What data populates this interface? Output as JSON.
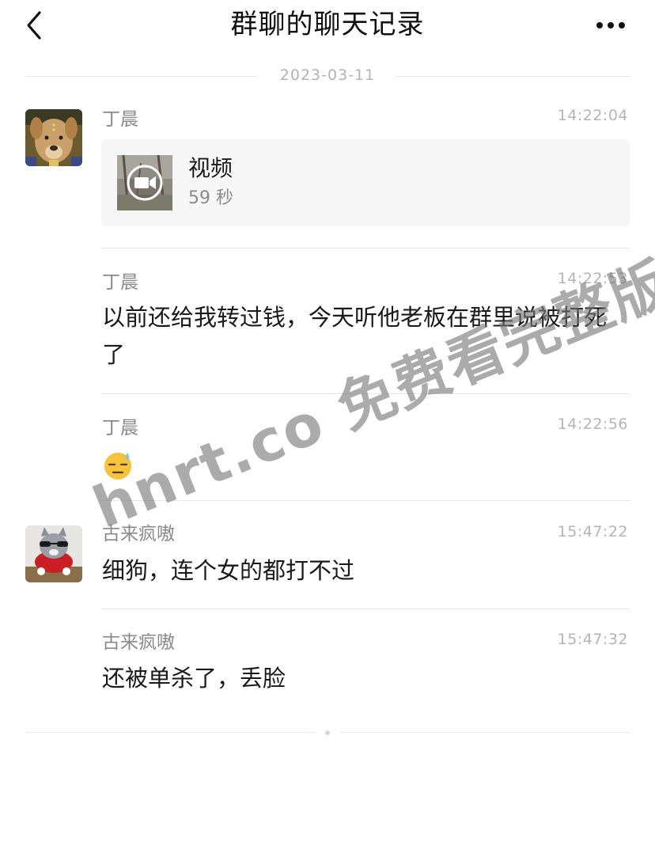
{
  "header": {
    "title": "群聊的聊天记录",
    "back_icon": "chevron-left-icon",
    "more_icon": "more-dots-icon"
  },
  "date_divider": "2023-03-11",
  "messages": [
    {
      "sender": "丁晨",
      "time": "14:22:04",
      "type": "video",
      "video": {
        "title": "视频",
        "duration": "59 秒"
      }
    },
    {
      "sender": "丁晨",
      "time": "14:22:53",
      "type": "text",
      "text": "以前还给我转过钱，今天听他老板在群里说被打死了"
    },
    {
      "sender": "丁晨",
      "time": "14:22:56",
      "type": "emoji",
      "emoji": "😓"
    },
    {
      "sender": "古来疯嗷",
      "time": "15:47:22",
      "type": "text",
      "text": "细狗，连个女的都打不过"
    },
    {
      "sender": "古来疯嗷",
      "time": "15:47:32",
      "type": "text",
      "text": "还被单杀了，丢脸"
    }
  ],
  "watermark": "hnrt.co 免费看完整版",
  "colors": {
    "background": "#ffffff",
    "text_primary": "#1a1a1a",
    "text_secondary": "#8a8a8a",
    "time": "#b5b5b5",
    "divider": "#e6e6e6",
    "card_bg": "#f6f6f6"
  }
}
